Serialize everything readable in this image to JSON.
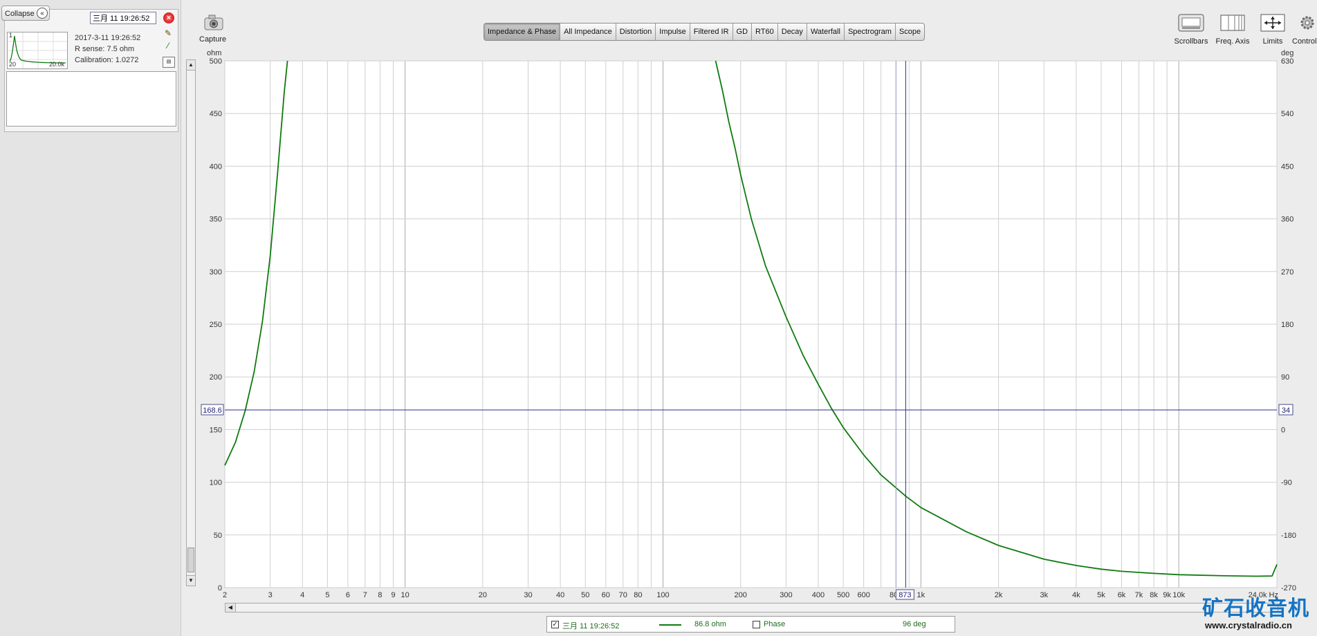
{
  "left_panel": {
    "collapse_label": "Collapse",
    "measurement": {
      "name": "三月 11 19:26:52",
      "index": "1",
      "thumb_xmin": "20",
      "thumb_xmax": "20.0k",
      "date": "2017-3-11 19:26:52",
      "r_sense": "R sense: 7.5 ohm",
      "calibration": "Calibration: 1.0272"
    }
  },
  "toolbar": {
    "capture_label": "Capture",
    "tabs": [
      {
        "label": "Impedance & Phase",
        "active": true
      },
      {
        "label": "All Impedance"
      },
      {
        "label": "Distortion"
      },
      {
        "label": "Impulse"
      },
      {
        "label": "Filtered IR"
      },
      {
        "label": "GD"
      },
      {
        "label": "RT60"
      },
      {
        "label": "Decay"
      },
      {
        "label": "Waterfall"
      },
      {
        "label": "Spectrogram"
      },
      {
        "label": "Scope"
      }
    ],
    "right_tools": [
      "Scrollbars",
      "Freq. Axis",
      "Limits",
      "Controls"
    ]
  },
  "chart_data": {
    "type": "line",
    "x_scale": "log",
    "xlim": [
      2,
      24000
    ],
    "x_ticks": [
      {
        "v": 2,
        "label": "2"
      },
      {
        "v": 3,
        "label": "3"
      },
      {
        "v": 4,
        "label": "4"
      },
      {
        "v": 5,
        "label": "5"
      },
      {
        "v": 6,
        "label": "6"
      },
      {
        "v": 7,
        "label": "7"
      },
      {
        "v": 8,
        "label": "8"
      },
      {
        "v": 9,
        "label": "9"
      },
      {
        "v": 10,
        "label": "10"
      },
      {
        "v": 20,
        "label": "20"
      },
      {
        "v": 30,
        "label": "30"
      },
      {
        "v": 40,
        "label": "40"
      },
      {
        "v": 50,
        "label": "50"
      },
      {
        "v": 60,
        "label": "60"
      },
      {
        "v": 70,
        "label": "70"
      },
      {
        "v": 80,
        "label": "80"
      },
      {
        "v": 100,
        "label": "100"
      },
      {
        "v": 200,
        "label": "200"
      },
      {
        "v": 300,
        "label": "300"
      },
      {
        "v": 400,
        "label": "400"
      },
      {
        "v": 500,
        "label": "500"
      },
      {
        "v": 600,
        "label": "600"
      },
      {
        "v": 800,
        "label": "800"
      },
      {
        "v": 1000,
        "label": "1k"
      },
      {
        "v": 2000,
        "label": "2k"
      },
      {
        "v": 3000,
        "label": "3k"
      },
      {
        "v": 4000,
        "label": "4k"
      },
      {
        "v": 5000,
        "label": "5k"
      },
      {
        "v": 6000,
        "label": "6k"
      },
      {
        "v": 7000,
        "label": "7k"
      },
      {
        "v": 8000,
        "label": "8k"
      },
      {
        "v": 9000,
        "label": "9k"
      },
      {
        "v": 10000,
        "label": "10k"
      },
      {
        "v": 24000,
        "label": "24.0k Hz"
      }
    ],
    "x_minor_grid": [
      90,
      700,
      900
    ],
    "left_axis": {
      "unit": "ohm",
      "ylim": [
        0,
        500
      ],
      "ticks": [
        0,
        50,
        100,
        150,
        200,
        250,
        300,
        350,
        400,
        450,
        500
      ]
    },
    "right_axis": {
      "unit": "deg",
      "ylim": [
        -270,
        630
      ],
      "ticks": [
        -270,
        -180,
        -90,
        0,
        90,
        180,
        270,
        360,
        450,
        540,
        630
      ]
    },
    "grid": true,
    "series": [
      {
        "name": "三月 11 19:26:52",
        "color": "#0e7a0e",
        "segments": [
          {
            "x": [
              2,
              2.2,
              2.4,
              2.6,
              2.8,
              3.0,
              3.2,
              3.4,
              3.5
            ],
            "y": [
              116,
              138,
              168,
              205,
              253,
              315,
              392,
              470,
              500
            ]
          },
          {
            "x": [
              160,
              170,
              180,
              190,
              200,
              220,
              250,
              300,
              350,
              400,
              450,
              500,
              600,
              700,
              873,
              1000,
              1500,
              2000,
              3000,
              4000,
              5000,
              6000,
              8000,
              10000,
              15000,
              20000,
              23000,
              24000
            ],
            "y": [
              500,
              472,
              442,
              418,
              392,
              350,
              305,
              257,
              220,
              193,
              170,
              152,
              126,
              107,
              86.8,
              76,
              53,
              40,
              27,
              21,
              17.5,
              15.5,
              13.5,
              12.3,
              11.2,
              10.8,
              11,
              22
            ]
          }
        ]
      }
    ],
    "cursor": {
      "x_label": "873",
      "x": 873,
      "y_left_label": "168.6",
      "y": 168.6,
      "y_right_label": "34"
    }
  },
  "legend": {
    "trace_name": "三月 11 19:26:52",
    "trace_value": "86.8 ohm",
    "phase_label": "Phase",
    "phase_value": "96 deg"
  },
  "watermark": {
    "title": "矿石收音机",
    "url": "www.crystalradio.cn"
  }
}
